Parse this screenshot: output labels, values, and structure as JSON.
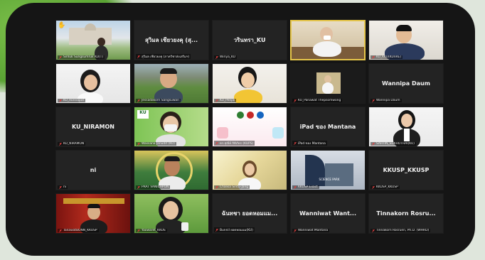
{
  "participants": [
    {
      "name": "",
      "caption": "Siriluk Sungsumruk KU(T)",
      "type": "video",
      "scene": "building"
    },
    {
      "name": "สุวิมล เชียวยงคุ (สุ...",
      "caption": "สุวิมล เชียวยงคุ (ภาควิชาส่งเสริมฯ)",
      "type": "name"
    },
    {
      "name": "วรินทรา_KU",
      "caption": "Wiriya_KU",
      "type": "name"
    },
    {
      "name": "",
      "caption": "",
      "type": "video",
      "scene": "office-man",
      "active": true
    },
    {
      "name": "",
      "caption": "KU_KKU(KUnRE)",
      "type": "video",
      "scene": "man-glasses"
    },
    {
      "name": "",
      "caption": "KU_Ronnapat",
      "type": "video",
      "scene": "woman"
    },
    {
      "name": "",
      "caption": "Jessadakorn Sangsuwan",
      "type": "video",
      "scene": "field-man"
    },
    {
      "name": "",
      "caption": "KU_Penjai",
      "type": "video",
      "scene": "young-man"
    },
    {
      "name": "",
      "caption": "KU_Panawat Thepsomwong",
      "type": "video",
      "scene": "small-person"
    },
    {
      "name": "Wannipa Daum",
      "caption": "Wannipa Daum",
      "type": "name"
    },
    {
      "name": "KU_NIRAMON",
      "caption": "KU_NIRAMON",
      "type": "name"
    },
    {
      "name": "",
      "caption": "Wassana Janudit (KU)",
      "type": "video",
      "scene": "mask-woman"
    },
    {
      "name": "",
      "caption": "ดร.สุณีย์ กิติภัทร (KUPS)",
      "type": "video",
      "scene": "graphic"
    },
    {
      "name": "iPad ของ Mantana",
      "caption": "iPad ของ Mantana",
      "type": "name"
    },
    {
      "name": "",
      "caption": "SAHTIN_SUKHOTHAI(KU)",
      "type": "video",
      "scene": "suit-woman"
    },
    {
      "name": "ni",
      "caption": "ni",
      "type": "name"
    },
    {
      "name": "",
      "caption": "PRAT VANICHPON",
      "type": "video",
      "scene": "smile-man"
    },
    {
      "name": "",
      "caption": "Chalisa Sintu-Jang",
      "type": "video",
      "scene": "sun-woman"
    },
    {
      "name": "",
      "caption": "KKUSP Exact",
      "type": "video",
      "scene": "science-park"
    },
    {
      "name": "KKUSP_KKUSP",
      "caption": "KKUSP_KKUSP",
      "type": "name"
    },
    {
      "name": "",
      "caption": "TanawatBONN_KKUSP",
      "type": "video",
      "scene": "red-room"
    },
    {
      "name": "",
      "caption": "Yaowaret_KKUS",
      "type": "video",
      "scene": "green-woman"
    },
    {
      "name": "ฉันทชา ยอดหอมแม...",
      "caption": "Bunnil ยอดหอมแม(KU)",
      "type": "name"
    },
    {
      "name": "Wanniwat Want...",
      "caption": "Wanniwat Mantana",
      "type": "name"
    },
    {
      "name": "Tinnakorn Rosru...",
      "caption": "Tinnakorn Rosruen, Ph.D. (WHRD)",
      "type": "name"
    }
  ],
  "raised_hand_icon": "hand-icon",
  "mic_icon": "microphone-off-icon",
  "colors": {
    "tile_bg": "#232323",
    "active_border": "#e6c64a",
    "frame": "#151515"
  }
}
